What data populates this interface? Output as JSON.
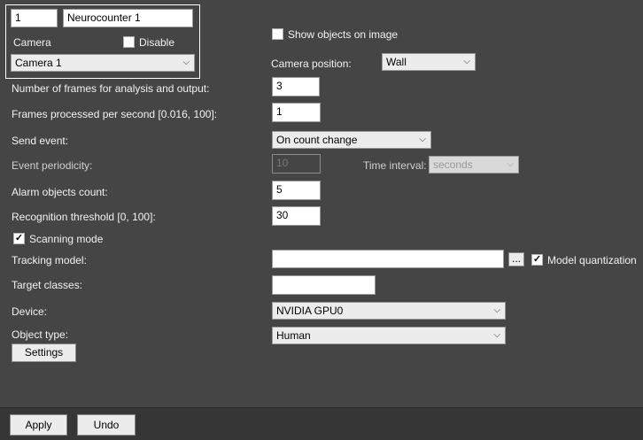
{
  "detector": {
    "id_value": "1",
    "name_value": "Neurocounter 1",
    "camera_label": "Camera",
    "disable_label": "Disable",
    "disable_checked": false,
    "camera_select": "Camera 1"
  },
  "show_objects": {
    "label": "Show objects on image",
    "checked": false
  },
  "camera_position": {
    "label": "Camera position:",
    "value": "Wall"
  },
  "frames_analysis": {
    "label": "Number of frames for analysis and output:",
    "value": "3"
  },
  "frames_per_second": {
    "label": "Frames processed per second [0.016, 100]:",
    "value": "1"
  },
  "send_event": {
    "label": "Send event:",
    "value": "On count change"
  },
  "event_periodicity": {
    "label": "Event periodicity:",
    "value": "10"
  },
  "time_interval": {
    "label": "Time interval:",
    "value": "seconds"
  },
  "alarm_objects": {
    "label": "Alarm objects count:",
    "value": "5"
  },
  "recognition_threshold": {
    "label": "Recognition threshold [0, 100]:",
    "value": "30"
  },
  "scanning_mode": {
    "label": "Scanning mode",
    "checked": true
  },
  "tracking_model": {
    "label": "Tracking model:",
    "value": "",
    "browse_label": "..."
  },
  "model_quantization": {
    "label": "Model quantization",
    "checked": true
  },
  "target_classes": {
    "label": "Target classes:",
    "value": ""
  },
  "device": {
    "label": "Device:",
    "value": "NVIDIA GPU0"
  },
  "object_type": {
    "label": "Object type:",
    "value": "Human"
  },
  "settings_button": "Settings",
  "footer": {
    "apply": "Apply",
    "undo": "Undo"
  },
  "icons": {
    "dropdown": "chevron-down-icon",
    "check": "checkmark-icon"
  }
}
